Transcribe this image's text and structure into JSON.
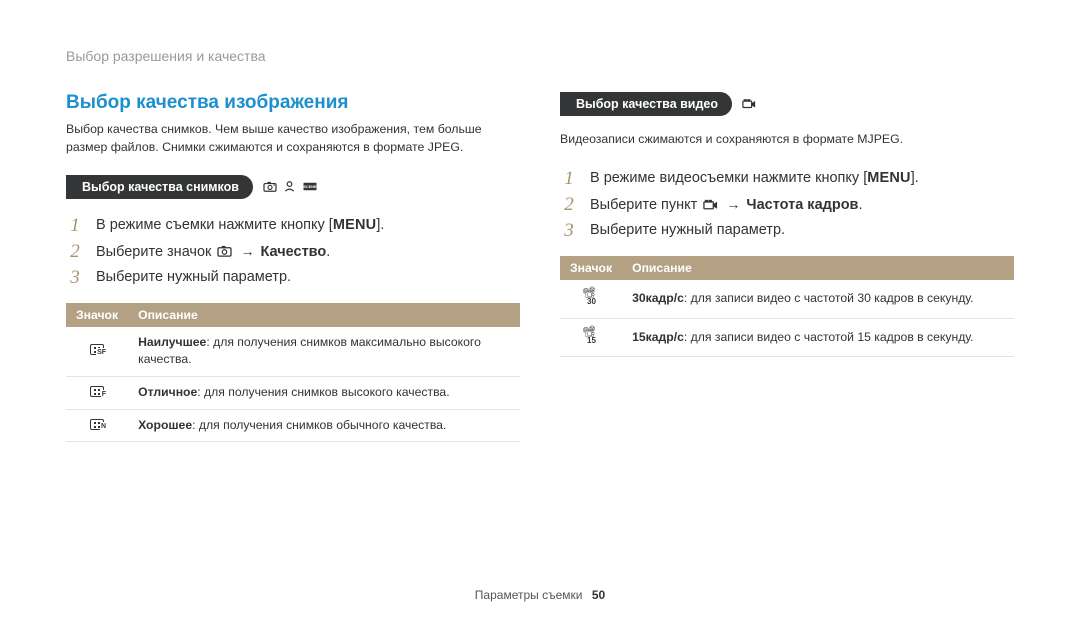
{
  "breadcrumb": "Выбор разрешения и качества",
  "left": {
    "title": "Выбор качества изображения",
    "intro": "Выбор качества снимков. Чем выше качество изображения, тем больше размер файлов. Снимки сжимаются и сохраняются в формате JPEG.",
    "pill": "Выбор качества снимков",
    "steps": {
      "s1_a": "В режиме съемки нажмите кнопку [",
      "s1_menu": "MENU",
      "s1_b": "].",
      "s2_a": "Выберите значок ",
      "s2_bold": "Качество",
      "s3": "Выберите нужный параметр."
    },
    "table": {
      "h1": "Значок",
      "h2": "Описание",
      "rows": [
        {
          "bold": "Наилучшее",
          "rest": ": для получения снимков максимально высокого качества."
        },
        {
          "bold": "Отличное",
          "rest": ": для получения снимков высокого качества."
        },
        {
          "bold": "Хорошее",
          "rest": ": для получения снимков обычного качества."
        }
      ]
    }
  },
  "right": {
    "pill": "Выбор качества видео",
    "intro": "Видеозаписи сжимаются и сохраняются в формате MJPEG.",
    "steps": {
      "s1_a": "В режиме видеосъемки нажмите кнопку [",
      "s1_menu": "MENU",
      "s1_b": "].",
      "s2_a": "Выберите пункт ",
      "s2_bold": "Частота кадров",
      "s3": "Выберите нужный параметр."
    },
    "table": {
      "h1": "Значок",
      "h2": "Описание",
      "rows": [
        {
          "bold": "30кадр/с",
          "rest": ": для записи видео с частотой 30 кадров в секунду."
        },
        {
          "bold": "15кадр/с",
          "rest": ": для записи видео с частотой 15 кадров в секунду."
        }
      ]
    }
  },
  "footer": {
    "label": "Параметры съемки",
    "page": "50"
  },
  "glyphs": {
    "arrow": "→",
    "dot": "."
  }
}
